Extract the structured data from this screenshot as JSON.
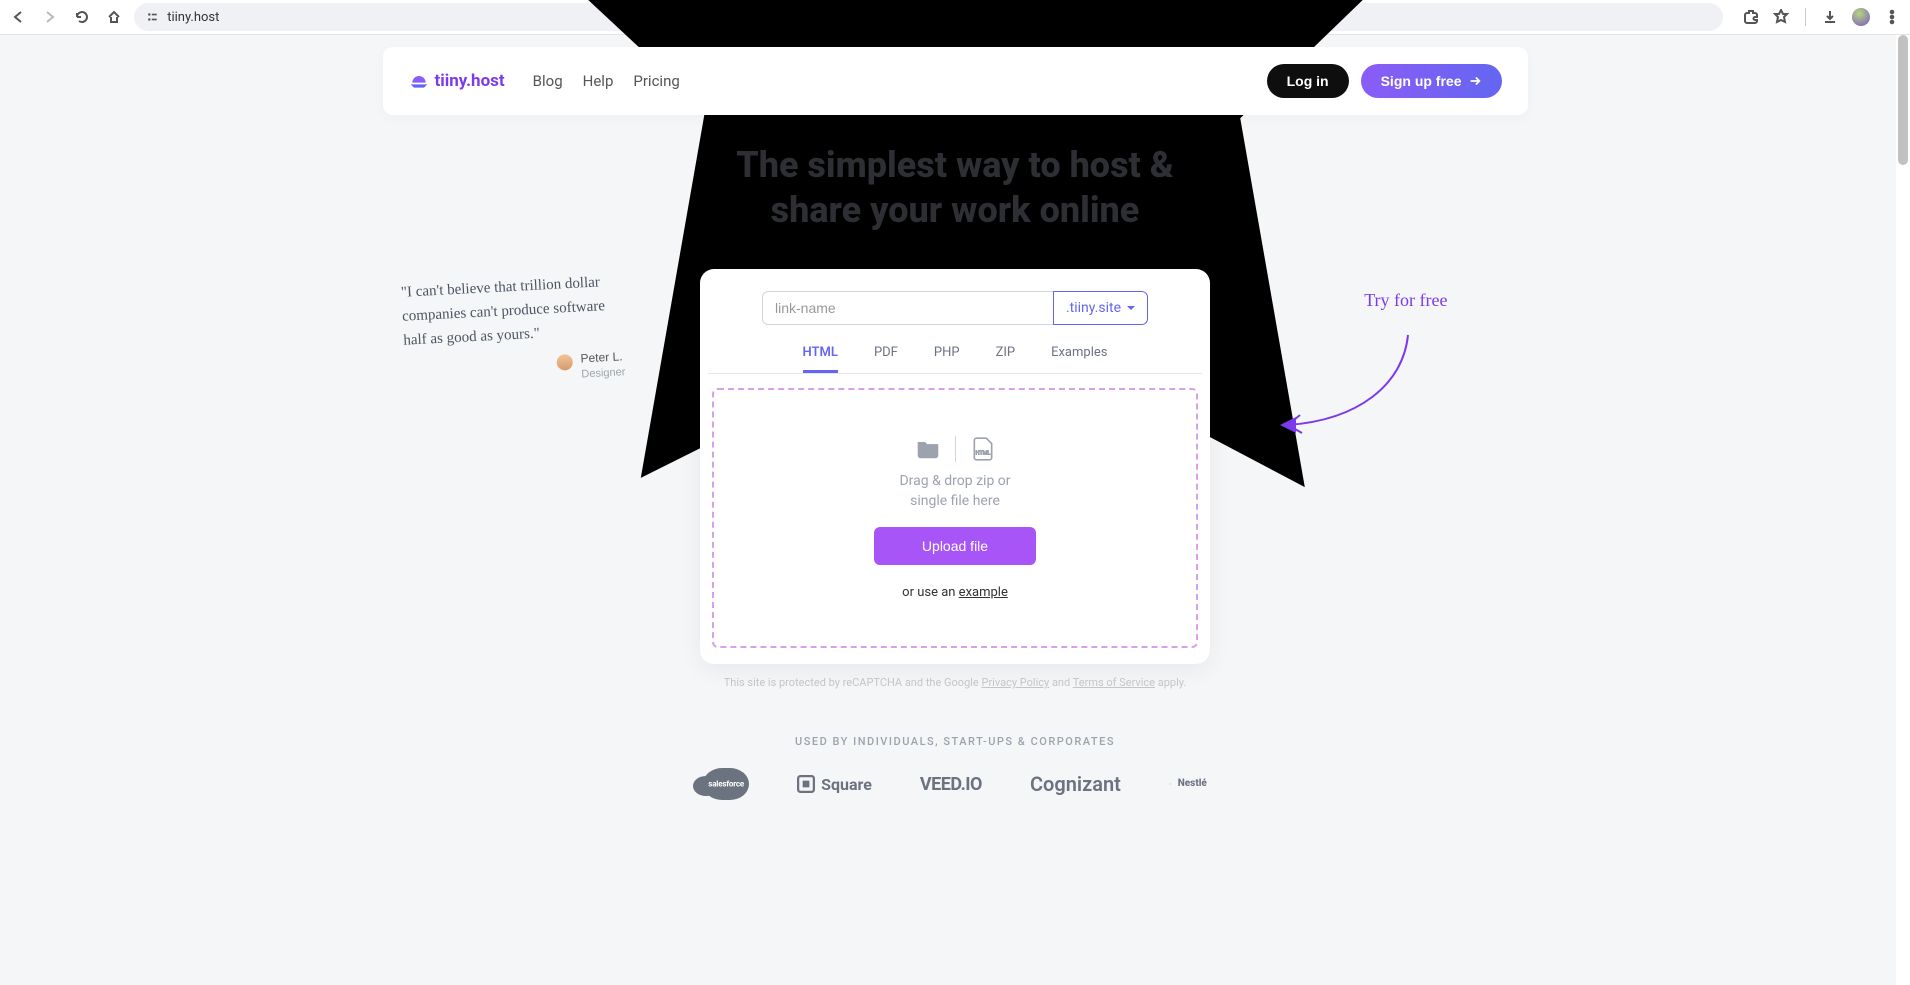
{
  "browser": {
    "url": "tiiny.host"
  },
  "header": {
    "logo_text": "tiiny.host",
    "nav": [
      "Blog",
      "Help",
      "Pricing"
    ],
    "login": "Log in",
    "signup": "Sign up free"
  },
  "hero": {
    "title_line1": "The simplest way to host &",
    "title_line2": "share your work online"
  },
  "uploader": {
    "link_placeholder": "link-name",
    "domain": ".tiiny.site",
    "tabs": [
      "HTML",
      "PDF",
      "PHP",
      "ZIP",
      "Examples"
    ],
    "active_tab_index": 0,
    "drop_text_line1": "Drag & drop zip or",
    "drop_text_line2": "single file here",
    "upload_btn": "Upload file",
    "example_prefix": "or use an ",
    "example_link": "example"
  },
  "recaptcha": {
    "prefix": "This site is protected by reCAPTCHA and the Google ",
    "privacy": "Privacy Policy",
    "and": " and ",
    "terms": "Terms of Service",
    "suffix": " apply."
  },
  "used_by": {
    "label": "USED BY INDIVIDUALS, START-UPS & CORPORATES",
    "brands": {
      "square": "Square",
      "veed": "VEED.IO",
      "cognizant": "Cognizant",
      "nestle": "Nestlé"
    }
  },
  "quote": {
    "text": "\"I can't believe that trillion dollar companies can't produce software half as good as yours.\"",
    "author": "Peter L.",
    "role": "Designer"
  },
  "annotation": {
    "try_free": "Try for free"
  }
}
